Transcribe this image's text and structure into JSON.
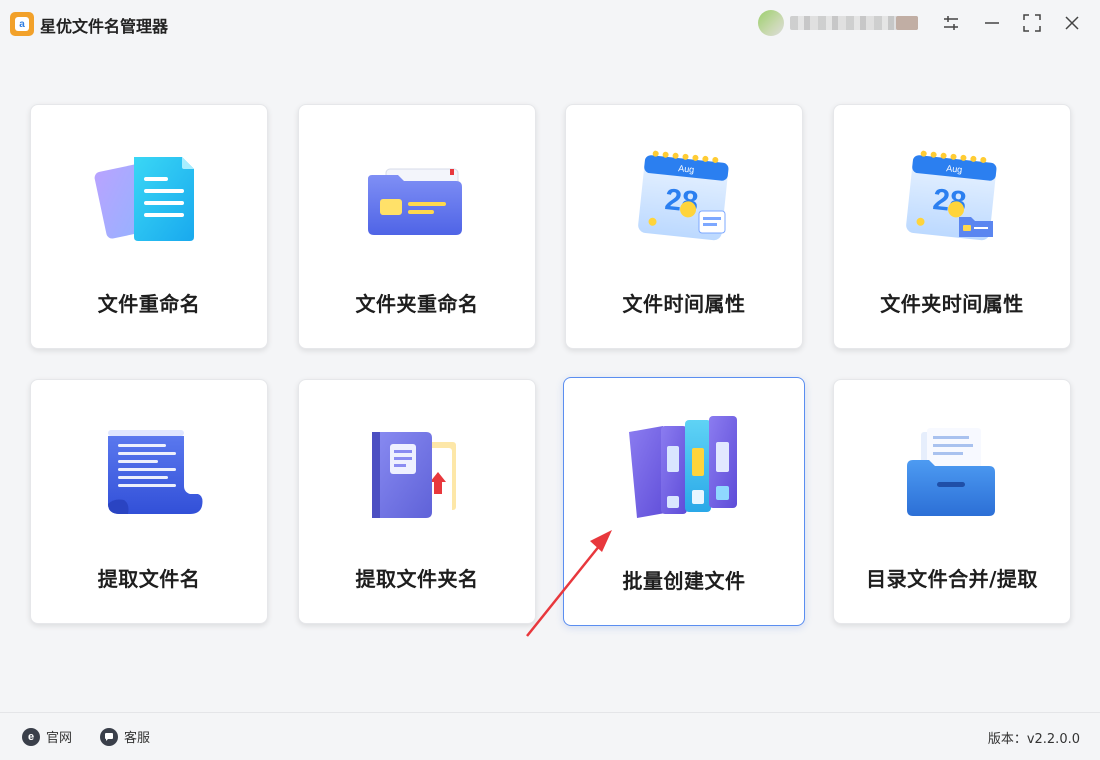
{
  "app": {
    "title": "星优文件名管理器",
    "logo_letter": "a"
  },
  "window_controls": {
    "settings_icon": "sliders-icon",
    "minimize_icon": "minimize-icon",
    "maximize_icon": "maximize-icon",
    "close_icon": "close-icon"
  },
  "tools": [
    {
      "label": "文件重命名",
      "icon": "documents-icon"
    },
    {
      "label": "文件夹重命名",
      "icon": "folder-icon"
    },
    {
      "label": "文件时间属性",
      "icon": "calendar-file-icon",
      "calendar_month": "Aug",
      "calendar_day": "28"
    },
    {
      "label": "文件夹时间属性",
      "icon": "calendar-folder-icon",
      "calendar_month": "Aug",
      "calendar_day": "28"
    },
    {
      "label": "提取文件名",
      "icon": "scroll-list-icon"
    },
    {
      "label": "提取文件夹名",
      "icon": "binder-export-icon"
    },
    {
      "label": "批量创建文件",
      "icon": "books-icon",
      "selected": true
    },
    {
      "label": "目录文件合并/提取",
      "icon": "file-drawer-icon"
    }
  ],
  "footer": {
    "website_label": "官网",
    "website_icon_letter": "e",
    "support_label": "客服",
    "version_text": "版本：v2.2.0.0"
  },
  "colors": {
    "accent": "#5b8ef0",
    "annotation": "#e8383d"
  }
}
